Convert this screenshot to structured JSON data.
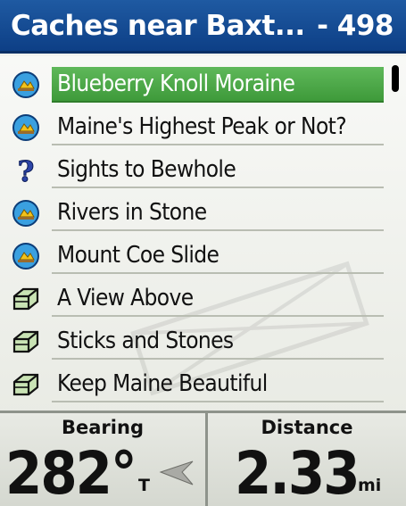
{
  "header": {
    "title": "Caches near Baxt...",
    "count": "- 498"
  },
  "list": {
    "items": [
      {
        "label": "Blueberry Knoll Moraine",
        "icon": "earthcache-icon",
        "selected": true
      },
      {
        "label": "Maine's Highest Peak or Not?",
        "icon": "earthcache-icon",
        "selected": false
      },
      {
        "label": "Sights to Bewhole",
        "icon": "mystery-cache-icon",
        "selected": false
      },
      {
        "label": "Rivers in Stone",
        "icon": "earthcache-icon",
        "selected": false
      },
      {
        "label": "Mount Coe Slide",
        "icon": "earthcache-icon",
        "selected": false
      },
      {
        "label": "A View Above",
        "icon": "traditional-cache-icon",
        "selected": false
      },
      {
        "label": "Sticks and Stones",
        "icon": "traditional-cache-icon",
        "selected": false
      },
      {
        "label": "Keep Maine Beautiful",
        "icon": "traditional-cache-icon",
        "selected": false
      }
    ]
  },
  "fields": {
    "bearing": {
      "label": "Bearing",
      "value": "282°",
      "unit": "T"
    },
    "distance": {
      "label": "Distance",
      "value": "2.33",
      "unit": "mi"
    }
  },
  "colors": {
    "header_bg": "#0d3f86",
    "selection": "#4aa845",
    "text": "#111111"
  }
}
